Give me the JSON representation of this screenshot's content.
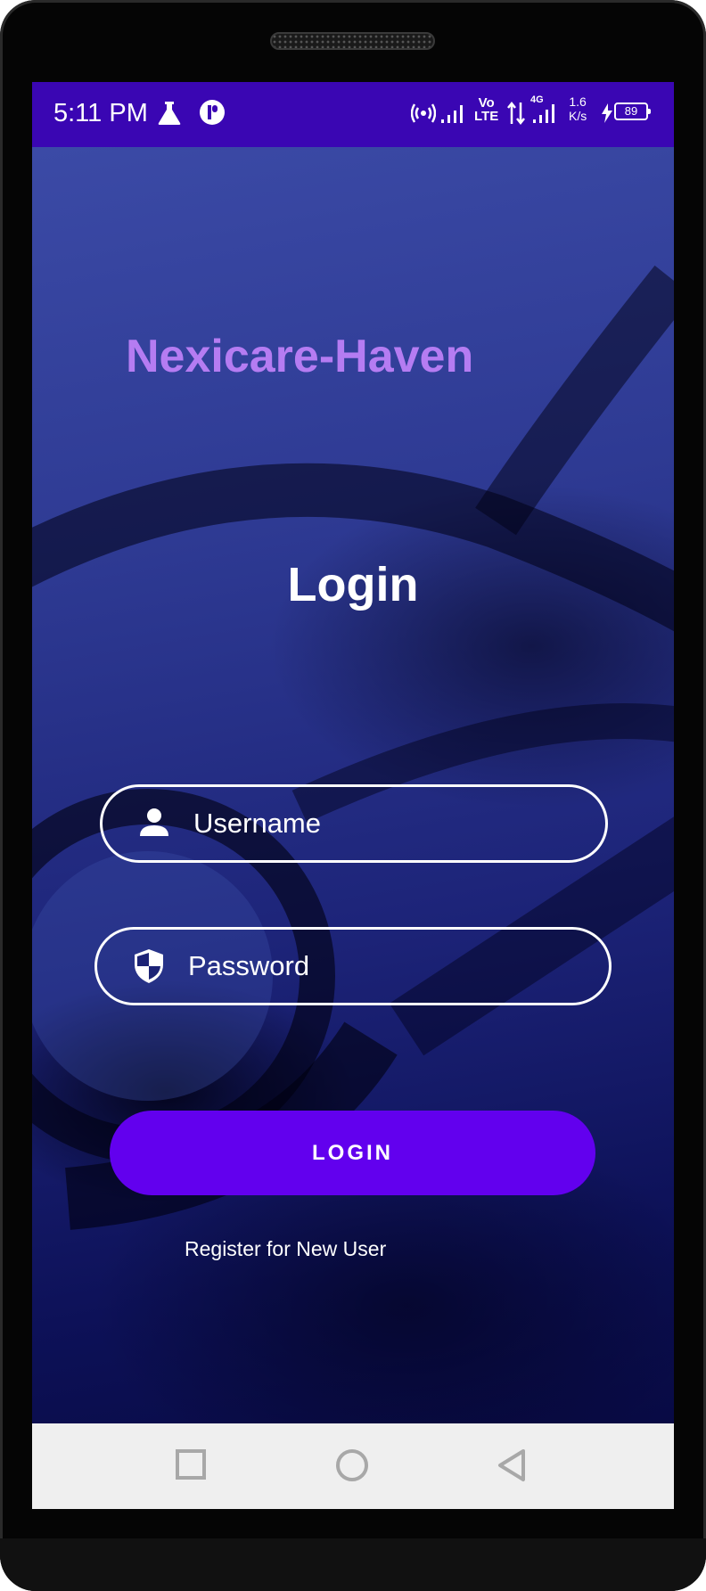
{
  "status_bar": {
    "time": "5:11 PM",
    "icons": [
      "lab-flask-icon",
      "app-notification-icon",
      "hotspot-icon",
      "signal-icon",
      "volte-icon",
      "data-arrows-icon",
      "signal-4g-icon",
      "battery-icon"
    ],
    "volte_label_top": "Vo",
    "volte_label_bottom": "LTE",
    "network_type": "4G",
    "speed_value": "1.6",
    "speed_unit": "K/s",
    "battery_level": "89",
    "background_color": "#3a06b3"
  },
  "app": {
    "title": "Nexicare-Haven",
    "title_color": "#b57cf2",
    "heading": "Login",
    "username_field": {
      "label": "Username",
      "icon": "person-icon"
    },
    "password_field": {
      "label": "Password",
      "icon": "shield-icon"
    },
    "login_button": {
      "label": "LOGIN",
      "color": "#6200ee"
    },
    "register_link": "Register for New User"
  },
  "nav_bar": {
    "buttons": [
      "recents-square-icon",
      "home-circle-icon",
      "back-triangle-icon"
    ]
  }
}
